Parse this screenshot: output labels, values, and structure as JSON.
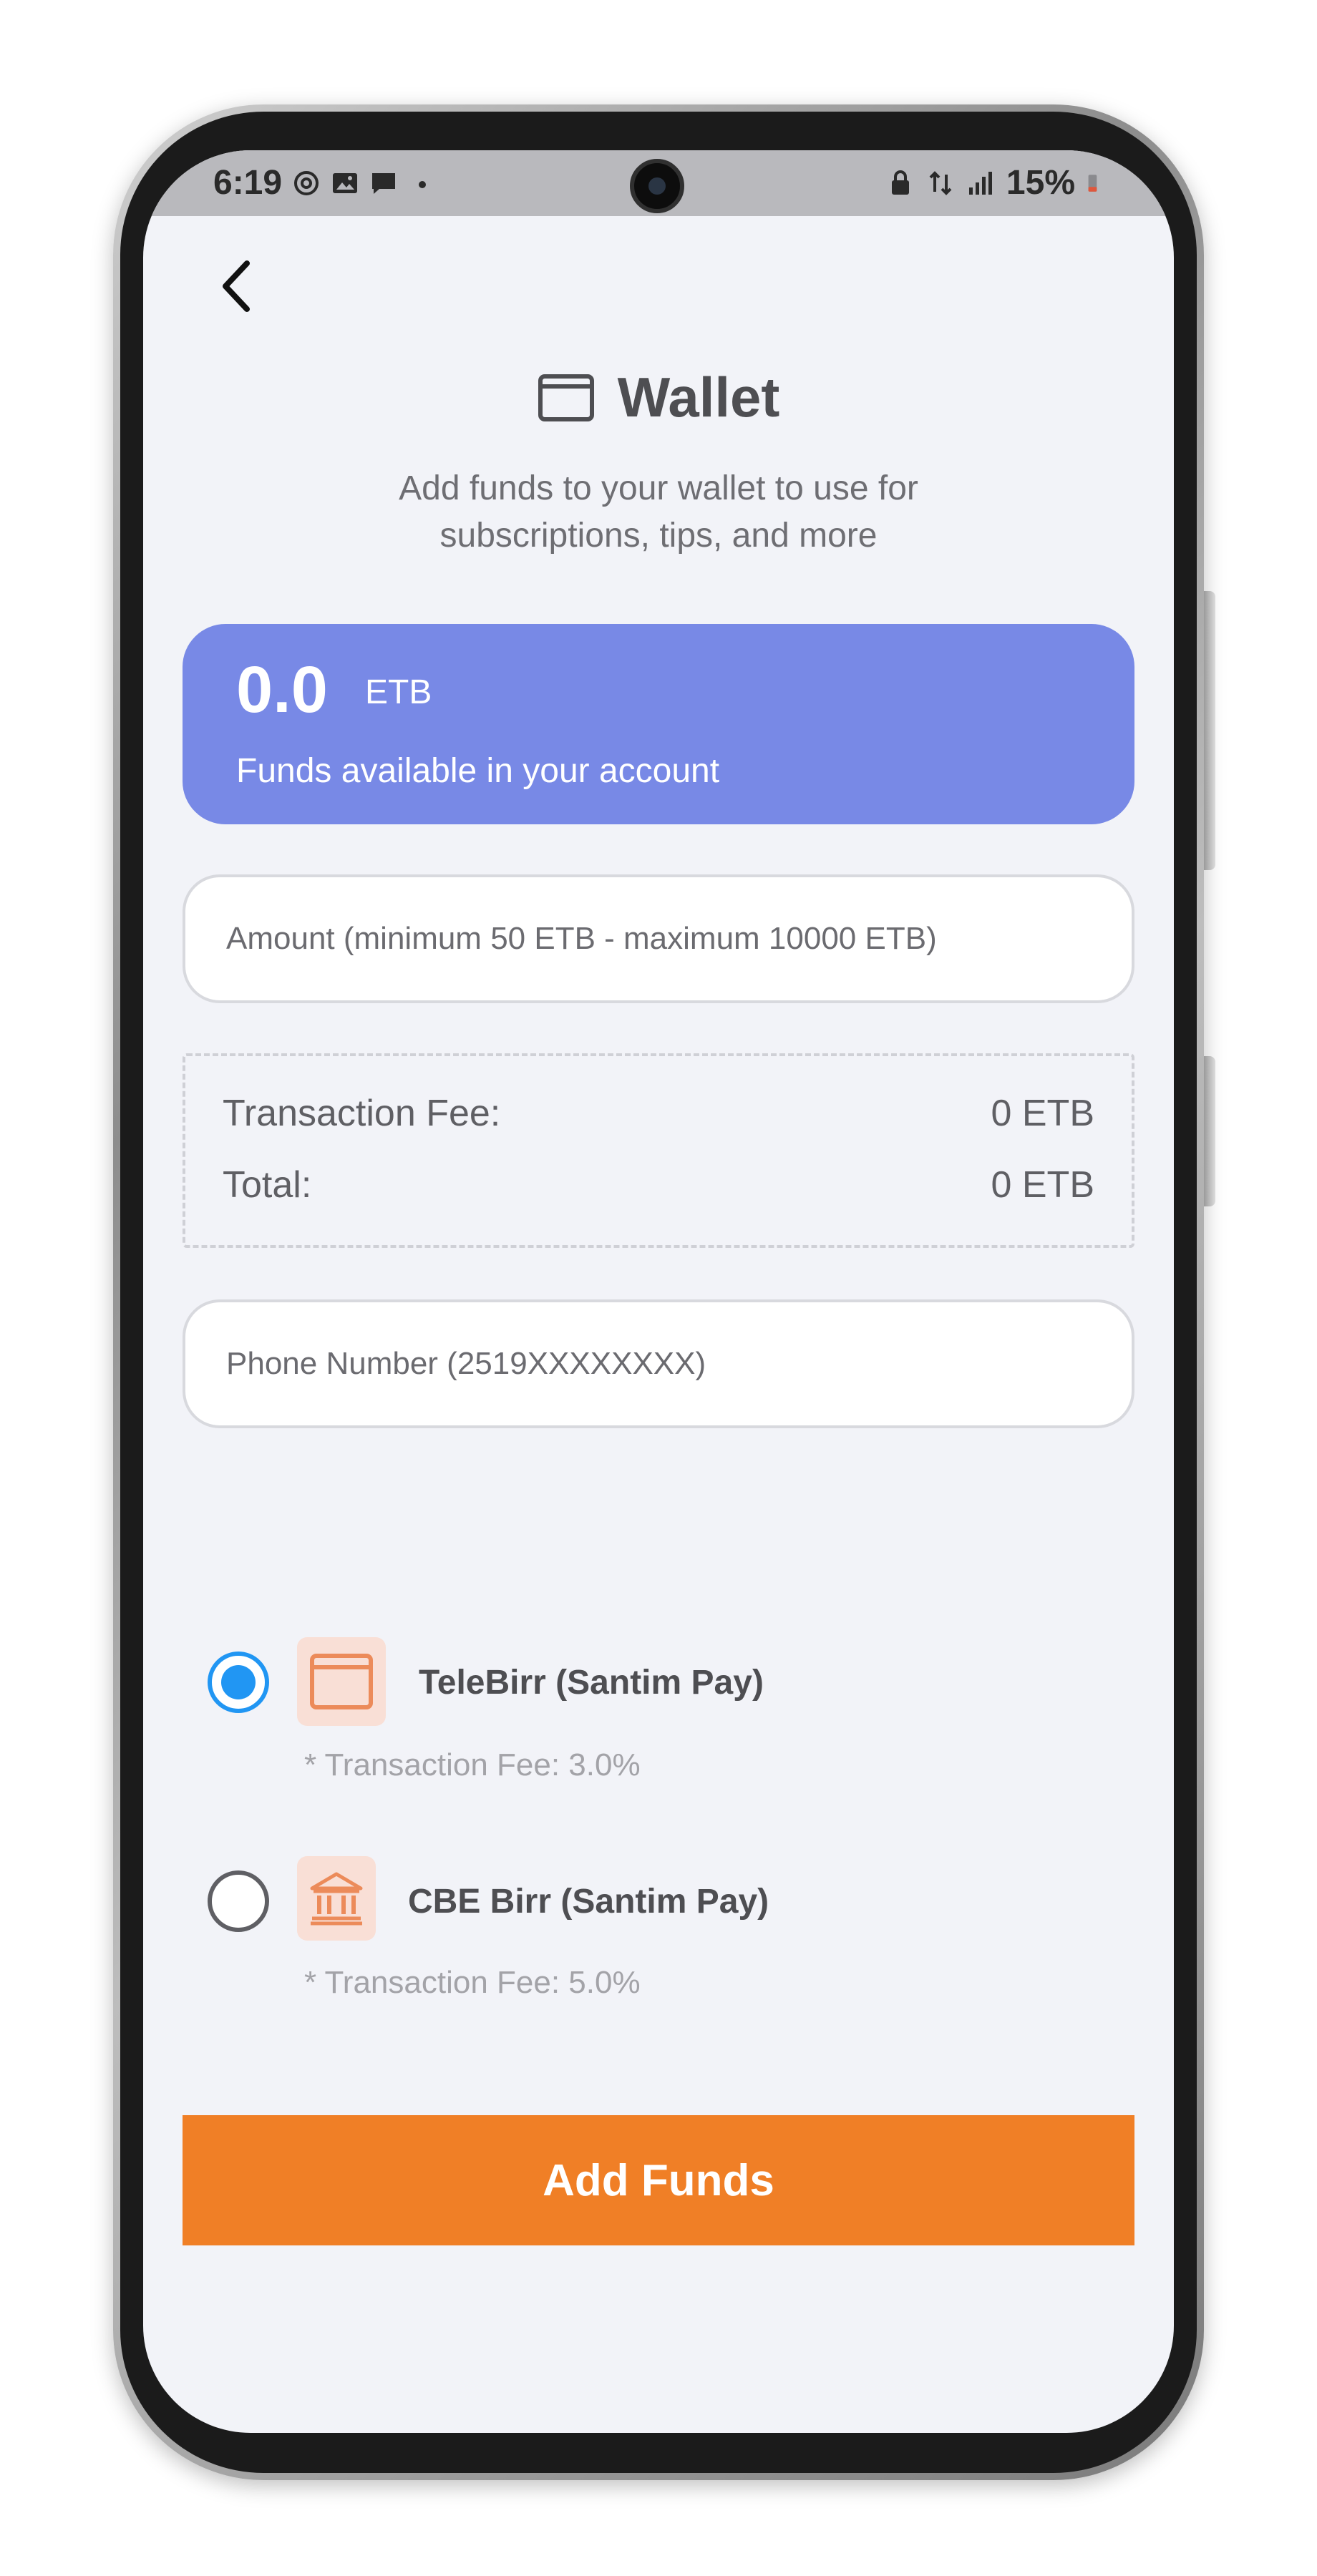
{
  "status_bar": {
    "time": "6:19",
    "battery": "15%"
  },
  "header": {
    "title": "Wallet",
    "subtitle": "Add funds to your wallet to use for subscriptions, tips, and more"
  },
  "balance": {
    "amount": "0.0",
    "currency": "ETB",
    "caption": "Funds available in your account"
  },
  "amount_input": {
    "placeholder": "Amount (minimum 50 ETB - maximum 10000 ETB)",
    "value": ""
  },
  "fees": {
    "transaction_fee_label": "Transaction Fee:",
    "transaction_fee_value": "0 ETB",
    "total_label": "Total:",
    "total_value": "0 ETB"
  },
  "phone_input": {
    "placeholder": "Phone Number (2519XXXXXXXX)",
    "value": ""
  },
  "payment_methods": [
    {
      "label": "TeleBirr (Santim Pay)",
      "fee_note": "* Transaction Fee: 3.0%",
      "icon": "wallet-icon",
      "selected": true
    },
    {
      "label": "CBE Birr (Santim Pay)",
      "fee_note": "* Transaction Fee: 5.0%",
      "icon": "bank-icon",
      "selected": false
    }
  ],
  "actions": {
    "add_funds_label": "Add Funds"
  },
  "colors": {
    "balance_card": "#7889e6",
    "primary_button": "#f07f26",
    "radio_selected": "#2196f3",
    "method_icon_bg": "#f9dfd6",
    "method_icon_fg": "#ec8b5a",
    "screen_bg": "#f2f3f8"
  }
}
